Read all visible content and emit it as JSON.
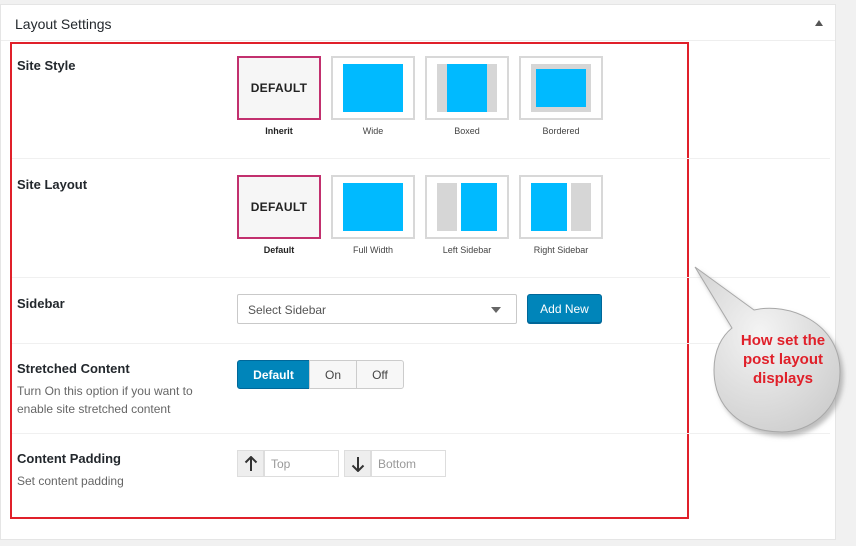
{
  "panel": {
    "title": "Layout Settings"
  },
  "site_style": {
    "label": "Site Style",
    "default_text": "DEFAULT",
    "options": [
      {
        "caption": "Inherit",
        "selected": true
      },
      {
        "caption": "Wide",
        "selected": false
      },
      {
        "caption": "Boxed",
        "selected": false
      },
      {
        "caption": "Bordered",
        "selected": false
      }
    ]
  },
  "site_layout": {
    "label": "Site Layout",
    "default_text": "DEFAULT",
    "options": [
      {
        "caption": "Default",
        "selected": true
      },
      {
        "caption": "Full Width",
        "selected": false
      },
      {
        "caption": "Left Sidebar",
        "selected": false
      },
      {
        "caption": "Right Sidebar",
        "selected": false
      }
    ]
  },
  "sidebar": {
    "label": "Sidebar",
    "select_value": "Select Sidebar",
    "add_new_label": "Add New"
  },
  "stretched_content": {
    "label": "Stretched Content",
    "description": "Turn On this option if you want to enable site stretched content",
    "options": [
      "Default",
      "On",
      "Off"
    ],
    "active": "Default"
  },
  "content_padding": {
    "label": "Content Padding",
    "description": "Set content padding",
    "top_placeholder": "Top",
    "bottom_placeholder": "Bottom"
  },
  "annotation": {
    "text": "How set the post layout displays"
  },
  "colors": {
    "accent_blue": "#00baff",
    "primary_button": "#0085ba",
    "selected_border": "#c2306e",
    "annotation_red": "#e0202a"
  }
}
